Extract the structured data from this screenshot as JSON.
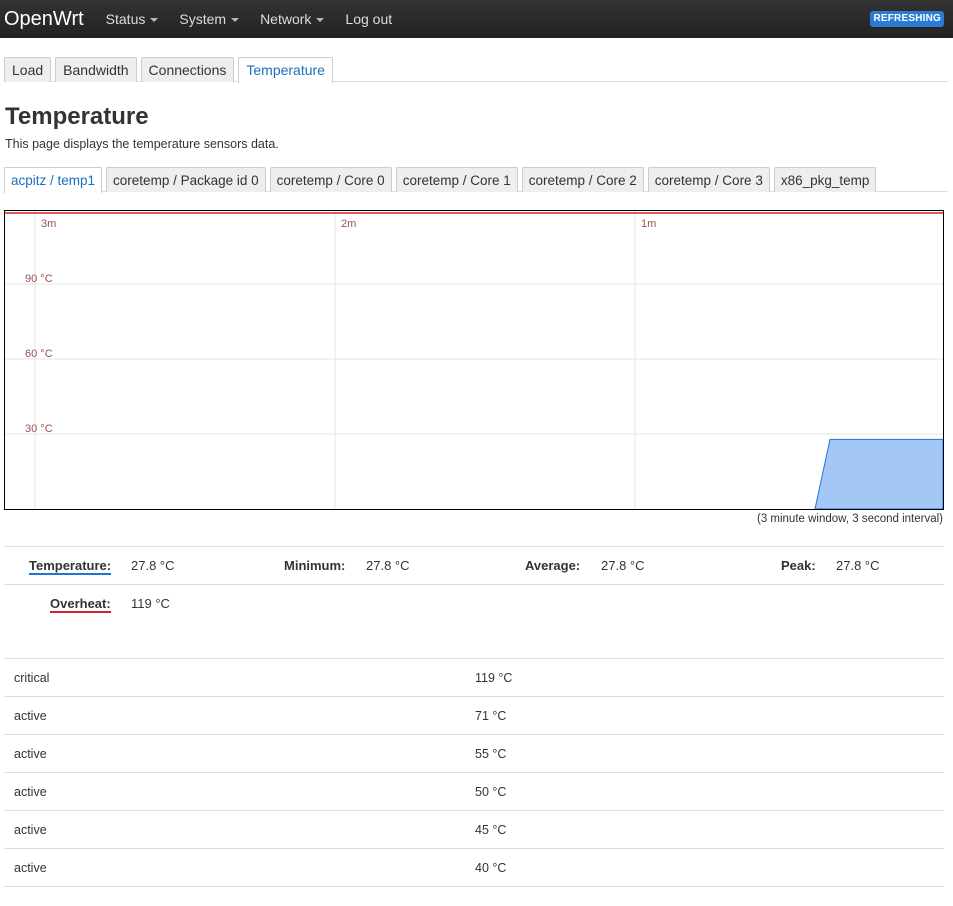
{
  "navbar": {
    "brand": "OpenWrt",
    "menu": [
      {
        "label": "Status",
        "has_dropdown": true
      },
      {
        "label": "System",
        "has_dropdown": true
      },
      {
        "label": "Network",
        "has_dropdown": true
      },
      {
        "label": "Log out",
        "has_dropdown": false
      }
    ],
    "refresh_badge": "REFRESHING",
    "badge_color": "#2a7bd4"
  },
  "main_tabs": [
    {
      "label": "Load",
      "active": false
    },
    {
      "label": "Bandwidth",
      "active": false
    },
    {
      "label": "Connections",
      "active": false
    },
    {
      "label": "Temperature",
      "active": true
    }
  ],
  "page": {
    "title": "Temperature",
    "description": "This page displays the temperature sensors data."
  },
  "sensor_tabs": [
    {
      "label": "acpitz / temp1",
      "active": true
    },
    {
      "label": "coretemp / Package id 0",
      "active": false
    },
    {
      "label": "coretemp / Core 0",
      "active": false
    },
    {
      "label": "coretemp / Core 1",
      "active": false
    },
    {
      "label": "coretemp / Core 2",
      "active": false
    },
    {
      "label": "coretemp / Core 3",
      "active": false
    },
    {
      "label": "x86_pkg_temp",
      "active": false
    }
  ],
  "chart_data": {
    "type": "area",
    "x_ticks": [
      "3m",
      "2m",
      "1m"
    ],
    "y_ticks": [
      "90 °C",
      "60 °C",
      "30 °C"
    ],
    "y_tick_values": [
      90,
      60,
      30
    ],
    "ylim": [
      0,
      119
    ],
    "series": [
      {
        "name": "Temperature",
        "color": "#1f77d4",
        "fill": "#a3c8f5",
        "value": 27.8
      },
      {
        "name": "Overheat",
        "color": "#d12525",
        "value": 119
      }
    ],
    "grid": true,
    "note": "(3 minute window, 3 second interval)"
  },
  "legend": {
    "temperature": {
      "label": "Temperature:",
      "value": "27.8 °C"
    },
    "minimum": {
      "label": "Minimum:",
      "value": "27.8 °C"
    },
    "average": {
      "label": "Average:",
      "value": "27.8 °C"
    },
    "peak": {
      "label": "Peak:",
      "value": "27.8 °C"
    },
    "overheat": {
      "label": "Overheat:",
      "value": "119 °C"
    }
  },
  "trip_points": [
    {
      "type": "critical",
      "temp": "119 °C"
    },
    {
      "type": "active",
      "temp": "71 °C"
    },
    {
      "type": "active",
      "temp": "55 °C"
    },
    {
      "type": "active",
      "temp": "50 °C"
    },
    {
      "type": "active",
      "temp": "45 °C"
    },
    {
      "type": "active",
      "temp": "40 °C"
    }
  ]
}
